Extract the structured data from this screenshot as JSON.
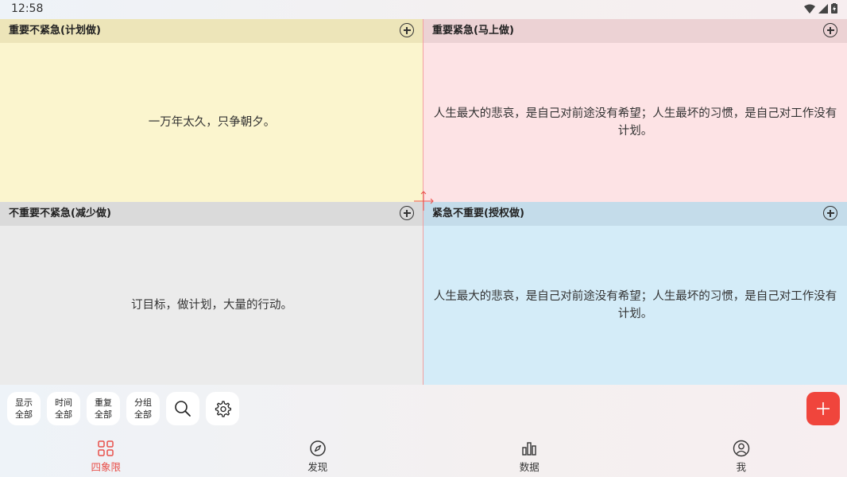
{
  "status_bar": {
    "time": "12:58"
  },
  "quadrants": [
    {
      "title": "重要不紧急(计划做)",
      "text": "一万年太久，只争朝夕。"
    },
    {
      "title": "重要紧急(马上做)",
      "text": "人生最大的悲哀，是自己对前途没有希望；人生最坏的习惯，是自己对工作没有计划。"
    },
    {
      "title": "不重要不紧急(减少做)",
      "text": "订目标，做计划，大量的行动。"
    },
    {
      "title": "紧急不重要(授权做)",
      "text": "人生最大的悲哀，是自己对前途没有希望；人生最坏的习惯，是自己对工作没有计划。"
    }
  ],
  "filters": [
    {
      "top": "显示",
      "bottom": "全部"
    },
    {
      "top": "时间",
      "bottom": "全部"
    },
    {
      "top": "重复",
      "bottom": "全部"
    },
    {
      "top": "分组",
      "bottom": "全部"
    }
  ],
  "tabs": [
    {
      "label": "四象限",
      "icon": "grid-icon"
    },
    {
      "label": "发现",
      "icon": "compass-icon"
    },
    {
      "label": "数据",
      "icon": "bar-chart-icon"
    },
    {
      "label": "我",
      "icon": "user-icon"
    }
  ],
  "colors": {
    "accent": "#f0453c",
    "active_tab": "#e8504a"
  }
}
